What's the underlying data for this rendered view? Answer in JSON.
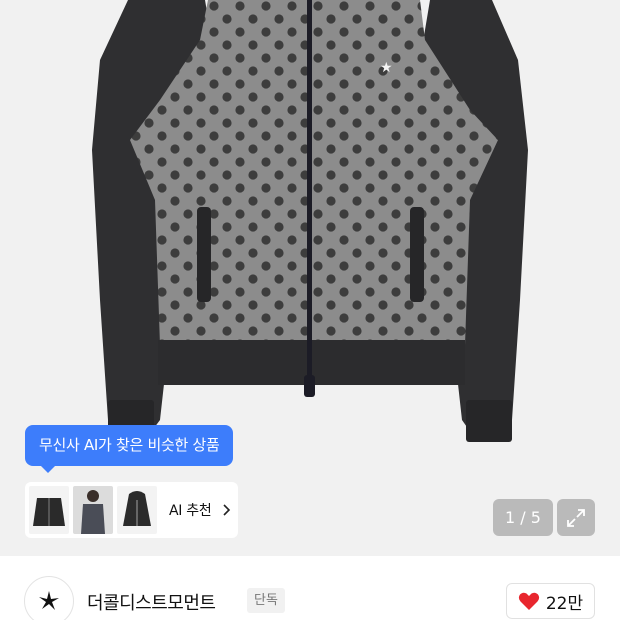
{
  "product": {
    "image_alt": "product-photo"
  },
  "ai_tooltip": {
    "text": "무신사 AI가 찾은 비슷한 상품"
  },
  "ai_recommend": {
    "label": "AI 추천"
  },
  "pager": {
    "text": "1 / 5",
    "current": 1,
    "total": 5
  },
  "brand": {
    "name": "더콜디스트모먼트",
    "badge": "단독"
  },
  "like": {
    "count": "22만"
  },
  "colors": {
    "accent_blue": "#3d7dfb",
    "heart_red": "#e8262e",
    "pager_bg": "#8a8a8a"
  },
  "icons": {
    "chevron": "chevron-right-icon",
    "expand": "expand-icon",
    "heart": "heart-icon",
    "logo": "star-logo-icon"
  }
}
